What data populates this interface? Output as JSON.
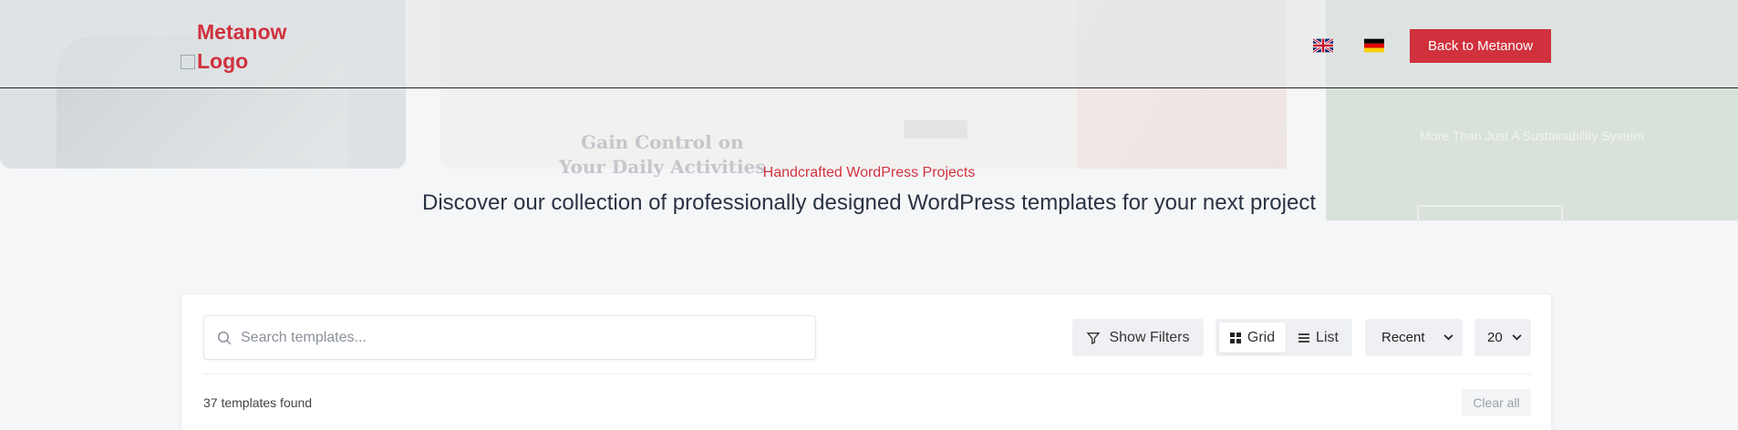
{
  "background": {
    "heading": "Gain Control on\nYour Daily Activities",
    "sustainability_headline": "More Than Just A Sustainability System"
  },
  "header": {
    "logo_alt": "Metanow Logo",
    "back_button": "Back to Metanow",
    "languages": [
      "en",
      "de"
    ]
  },
  "hero": {
    "eyebrow": "Handcrafted WordPress Projects",
    "subtitle": "Discover our collection of professionally designed WordPress templates for your next project"
  },
  "toolbar": {
    "search_placeholder": "Search templates...",
    "filters_label": "Show Filters",
    "view_grid_label": "Grid",
    "view_list_label": "List",
    "active_view": "Grid",
    "sort_value": "Recent",
    "per_page_value": "20"
  },
  "results": {
    "count_text": "37 templates found",
    "clear_label": "Clear all"
  },
  "colors": {
    "accent": "#d0313d",
    "text_dark": "#2a3342",
    "control_bg": "#eef0f3"
  },
  "icons": [
    "flag-uk-icon",
    "flag-de-icon",
    "search-icon",
    "filter-icon",
    "grid-icon",
    "list-icon",
    "chevron-down-icon"
  ]
}
